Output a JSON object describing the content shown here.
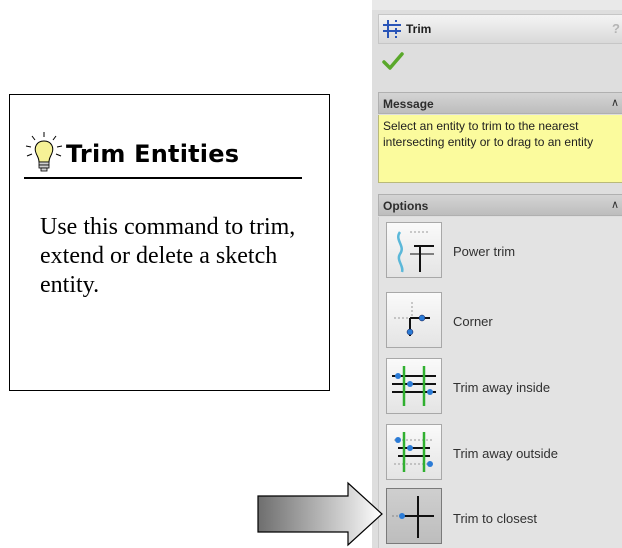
{
  "callout": {
    "title": "Trim Entities",
    "body": "Use this command to trim, extend or delete a sketch entity."
  },
  "panel": {
    "title": "Trim",
    "help": "?",
    "message_group": {
      "title": "Message",
      "text": "Select an entity to trim to the nearest intersecting entity or to drag to an entity"
    },
    "options_group": {
      "title": "Options"
    },
    "chevron": "≈",
    "options": [
      {
        "label": "Power trim",
        "icon": "power-trim-icon",
        "selected": false
      },
      {
        "label": "Corner",
        "icon": "corner-icon",
        "selected": false
      },
      {
        "label": "Trim away inside",
        "icon": "trim-away-inside-icon",
        "selected": false
      },
      {
        "label": "Trim away outside",
        "icon": "trim-away-outside-icon",
        "selected": false
      },
      {
        "label": "Trim to closest",
        "icon": "trim-to-closest-icon",
        "selected": true
      }
    ]
  },
  "colors": {
    "message_bg": "#fbfb9d",
    "ok_green": "#5aa82b",
    "accent_blue": "#2b7bd6",
    "trim_green": "#30b030"
  }
}
